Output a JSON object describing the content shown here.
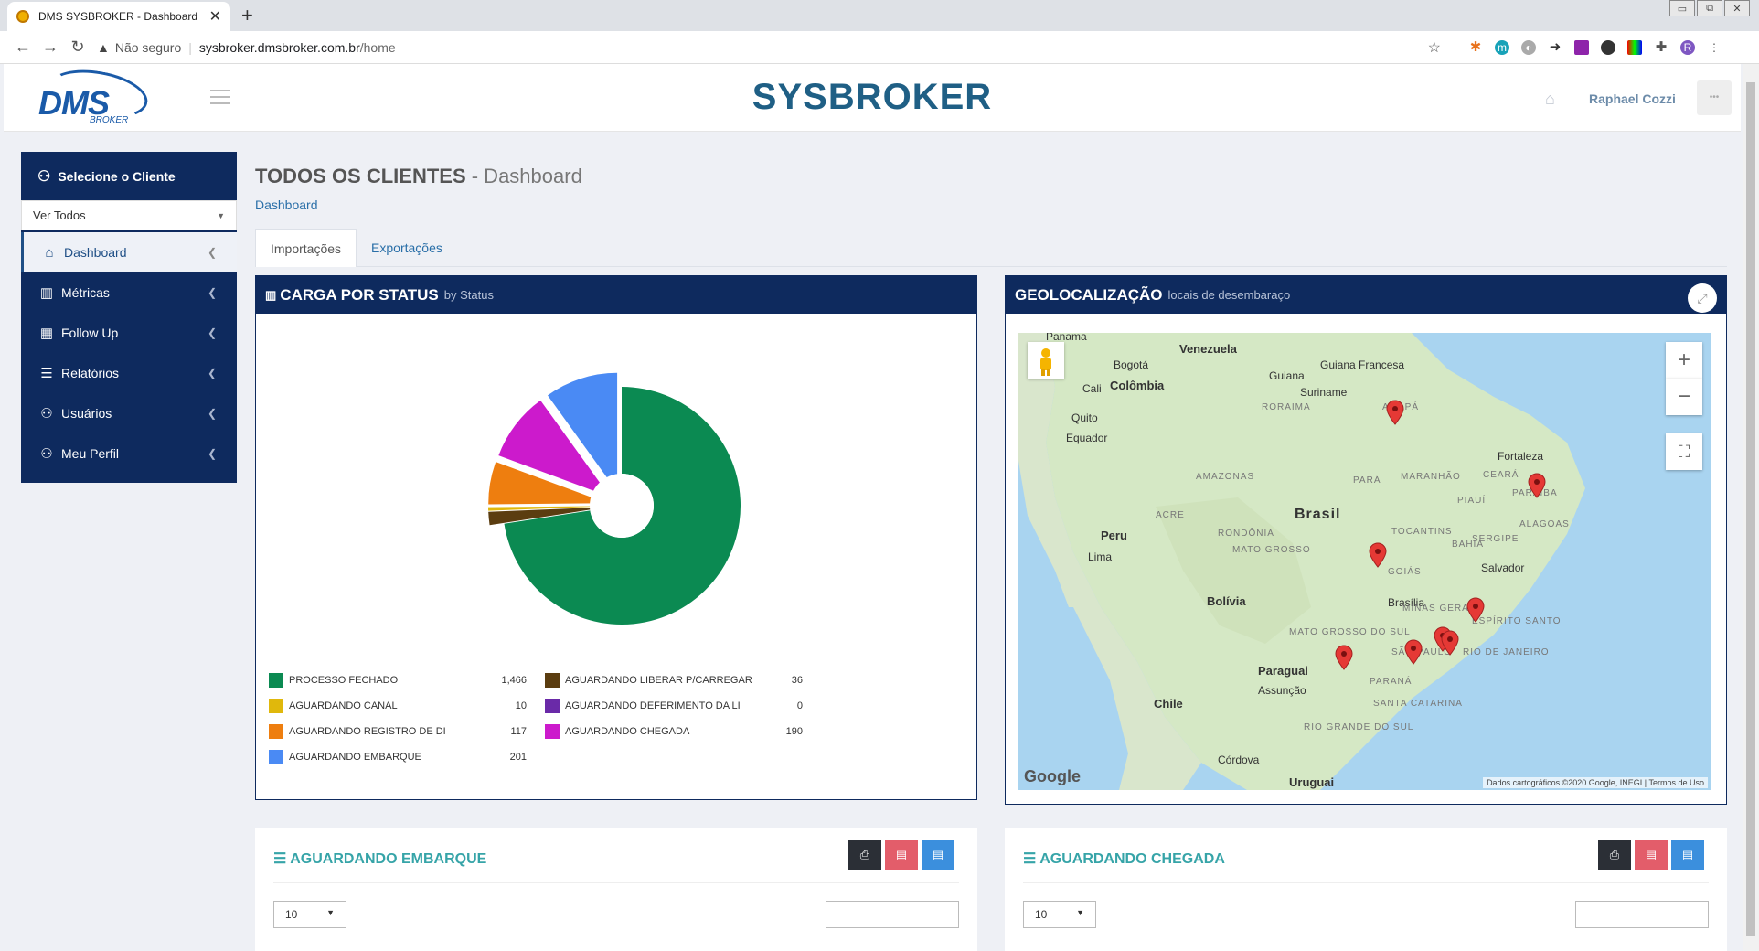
{
  "browser": {
    "tab_title": "DMS SYSBROKER - Dashboard",
    "security": "Não seguro",
    "url_host": "sysbroker.dmsbroker.com.br",
    "url_path": "/home"
  },
  "header": {
    "logo_text": "DMS",
    "logo_sub": "BROKER",
    "brand": "SYSBROKER",
    "user": "Raphael Cozzi"
  },
  "sidebar": {
    "title": "Selecione o Cliente",
    "select_value": "Ver Todos",
    "items": [
      {
        "label": "Dashboard",
        "icon": "home-icon"
      },
      {
        "label": "Métricas",
        "icon": "bar-chart-icon"
      },
      {
        "label": "Follow Up",
        "icon": "calendar-icon"
      },
      {
        "label": "Relatórios",
        "icon": "list-icon"
      },
      {
        "label": "Usuários",
        "icon": "user-icon"
      },
      {
        "label": "Meu Perfil",
        "icon": "user-icon"
      }
    ]
  },
  "page": {
    "title_bold": "TODOS OS CLIENTES",
    "title_rest": " - Dashboard",
    "breadcrumb": "Dashboard",
    "tabs": [
      "Importações",
      "Exportações"
    ]
  },
  "status_panel": {
    "title": "CARGA POR STATUS",
    "subtitle": "by Status"
  },
  "chart_data": {
    "type": "pie",
    "title": "CARGA POR STATUS",
    "series": [
      {
        "name": "PROCESSO FECHADO",
        "value": 1466,
        "label": "1,466",
        "color": "#0b8a52"
      },
      {
        "name": "AGUARDANDO CANAL",
        "value": 10,
        "label": "10",
        "color": "#e0b80c"
      },
      {
        "name": "AGUARDANDO REGISTRO DE DI",
        "value": 117,
        "label": "117",
        "color": "#ee7e0f"
      },
      {
        "name": "AGUARDANDO EMBARQUE",
        "value": 201,
        "label": "201",
        "color": "#4a8af4"
      },
      {
        "name": "AGUARDANDO LIBERAR P/CARREGAR",
        "value": 36,
        "label": "36",
        "color": "#5b3d10"
      },
      {
        "name": "AGUARDANDO DEFERIMENTO DA LI",
        "value": 0,
        "label": "0",
        "color": "#6a2aa8"
      },
      {
        "name": "AGUARDANDO CHEGADA",
        "value": 190,
        "label": "190",
        "color": "#cc1acc"
      }
    ],
    "legend": "bottom"
  },
  "geo_panel": {
    "title": "GEOLOCALIZAÇÃO",
    "subtitle": "locais de desembaraço",
    "labels": [
      "Panama",
      "Venezuela",
      "Bogotá",
      "Guiana",
      "Guiana Francesa",
      "Suriname",
      "Cali",
      "Colômbia",
      "Quito",
      "Equador",
      "RORAIMA",
      "AMAPÁ",
      "Fortaleza",
      "AMAZONAS",
      "PARÁ",
      "MARANHÃO",
      "CEARÁ",
      "PARAÍBA",
      "PIAUÍ",
      "Brasil",
      "ACRE",
      "Peru",
      "RONDÔNIA",
      "TOCANTINS",
      "ALAGOAS",
      "SERGIPE",
      "Lima",
      "MATO GROSSO",
      "BAHIA",
      "Salvador",
      "GOIÁS",
      "Bolívia",
      "Brasília",
      "MINAS GERAIS",
      "ESPÍRITO SANTO",
      "MATO GROSSO DO SUL",
      "RIO DE JANEIRO",
      "SÃO PAULO",
      "Paraguai",
      "Assunção",
      "PARANÁ",
      "Chile",
      "SANTA CATARINA",
      "RIO GRANDE DO SUL",
      "Córdova",
      "Uruguai"
    ],
    "google": "Google",
    "attribution": "Dados cartográficos ©2020 Google, INEGI",
    "terms": "Termos de Uso"
  },
  "lower_panels": {
    "left_title": "AGUARDANDO EMBARQUE",
    "right_title": "AGUARDANDO CHEGADA",
    "page_size": "10"
  }
}
